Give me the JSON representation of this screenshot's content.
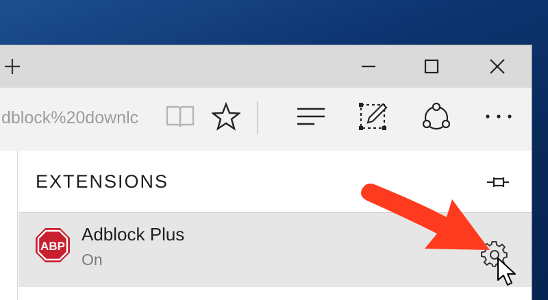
{
  "titlebar": {
    "new_tab_icon": "plus-icon",
    "minimize_icon": "minimize-icon",
    "maximize_icon": "maximize-icon",
    "close_icon": "close-icon"
  },
  "toolbar": {
    "address_text": "dblock%20downlc",
    "reading_view_icon": "book-icon",
    "favorite_icon": "star-icon",
    "hub_icon": "hub-lines-icon",
    "web_note_icon": "web-note-icon",
    "share_icon": "share-icon",
    "more_icon": "more-dots-icon"
  },
  "extensions_pane": {
    "title": "EXTENSIONS",
    "pin_icon": "pin-icon",
    "items": [
      {
        "name": "Adblock Plus",
        "state": "On",
        "logo_text": "ABP",
        "logo_color": "#c8202f",
        "settings_icon": "gear-icon"
      }
    ]
  },
  "annotation": {
    "arrow_color": "#ff3b1f"
  }
}
